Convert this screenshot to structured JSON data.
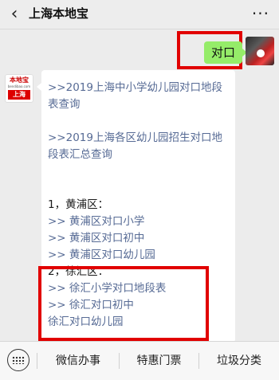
{
  "header": {
    "title": "上海本地宝",
    "back_icon": "chevron-left-icon",
    "more_icon": "more-dots-icon"
  },
  "outgoing_message": {
    "text": "对口"
  },
  "incoming_avatar": {
    "brand": "本地宝",
    "sub": "bendibao.com",
    "city": "上海"
  },
  "incoming_message": {
    "lines": [
      ">>2019上海中小学幼儿园对口地段",
      "表查询",
      "",
      ">>2019上海各区幼儿园招生对口地",
      "段表汇总查询",
      "",
      "",
      "1，黄浦区：",
      ">> 黄浦区对口小学",
      ">> 黄浦区对口初中",
      ">> 黄浦区对口幼儿园",
      "2，徐汇区：",
      ">> 徐汇小学对口地段表",
      ">> 徐汇对口初中",
      "徐汇对口幼儿园"
    ]
  },
  "bottom_menu": {
    "keyboard_icon": "keyboard-icon",
    "items": [
      "微信办事",
      "特惠门票",
      "垃圾分类"
    ]
  },
  "colors": {
    "highlight_border": "#e10000",
    "outgoing_bubble": "#95ec69",
    "link": "#576b95"
  }
}
